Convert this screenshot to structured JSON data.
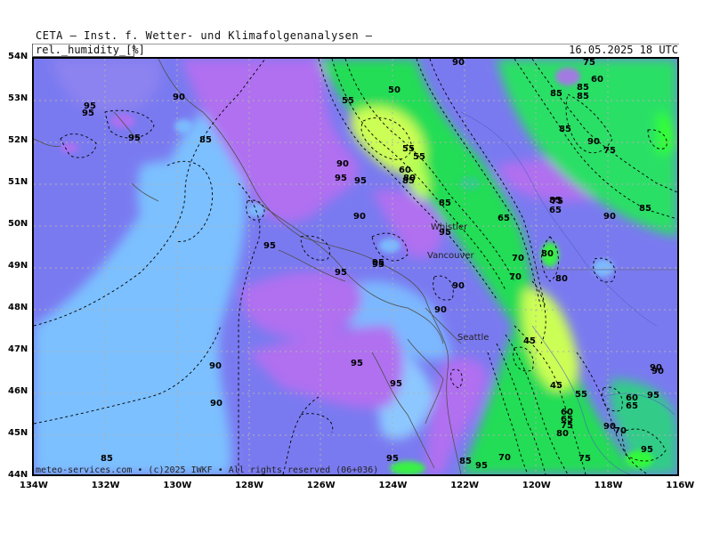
{
  "header": {
    "title": "CETA — Inst. f. Wetter- und Klimafolgenanalysen —",
    "variable": "rel._humidity_[%]",
    "valid_time": "16.05.2025 18 UTC"
  },
  "footer": {
    "copyright": "meteo-services.com • (c)2025 IWKF • All rights reserved (06+036)"
  },
  "axes": {
    "lat_labels": [
      "54N",
      "53N",
      "52N",
      "51N",
      "50N",
      "49N",
      "48N",
      "47N",
      "46N",
      "45N",
      "44N"
    ],
    "lon_labels": [
      "134W",
      "132W",
      "130W",
      "128W",
      "126W",
      "124W",
      "122W",
      "120W",
      "118W",
      "116W"
    ]
  },
  "cities": [
    {
      "name": "Whistler"
    },
    {
      "name": "Vancouver"
    },
    {
      "name": "Seattle"
    }
  ],
  "contour_labels": [
    "95",
    "90",
    "95",
    "85",
    "95",
    "90",
    "95",
    "90",
    "95",
    "95",
    "95",
    "95",
    "90",
    "95",
    "95",
    "90",
    "90",
    "85",
    "95",
    "85",
    "90",
    "55",
    "50",
    "55",
    "60",
    "65",
    "75",
    "90",
    "85",
    "95",
    "80",
    "65",
    "70",
    "70",
    "85",
    "80",
    "45",
    "45",
    "55",
    "60",
    "65",
    "75",
    "80",
    "60",
    "65",
    "85",
    "95",
    "90",
    "95",
    "75",
    "85",
    "85",
    "90",
    "85",
    "60",
    "75",
    "55",
    "80",
    "85",
    "95",
    "90",
    "95",
    "85",
    "90",
    "70",
    "75",
    "70",
    "90"
  ],
  "colors": {
    "ocean_light": "#7cc0ff",
    "ocean_mid": "#6fa0ff",
    "blue_purple": "#8282f0",
    "purple": "#b070f0",
    "magenta": "#d070f0",
    "green": "#22dd55",
    "bright_green": "#33ff33",
    "lime": "#ccff55",
    "teal": "#33c8b0",
    "coast": "#505050",
    "grid": "#b0b0b0"
  }
}
